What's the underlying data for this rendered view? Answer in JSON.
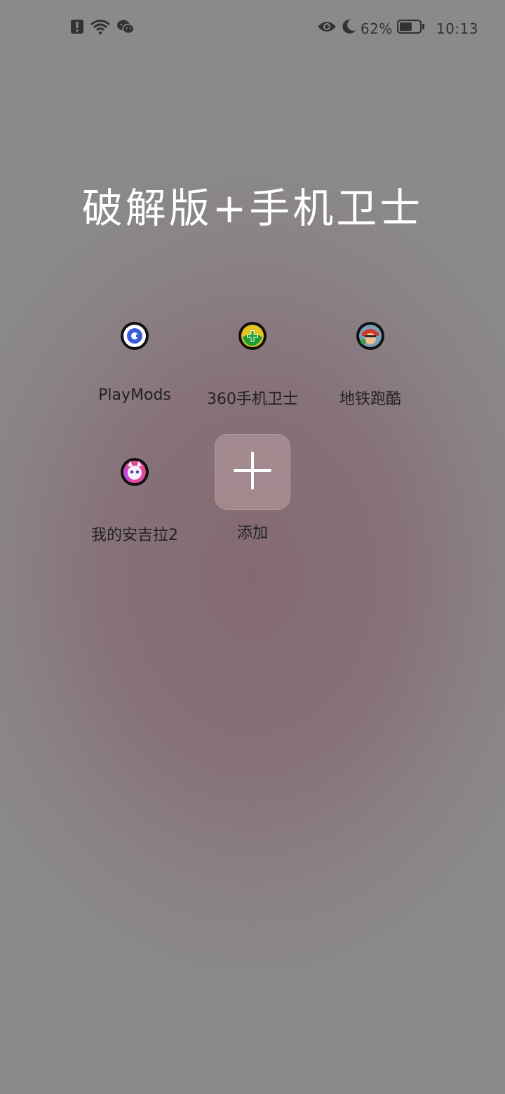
{
  "status_bar": {
    "left_icons": [
      "alert-icon",
      "wifi-icon",
      "wechat-icon"
    ],
    "right_icons": [
      "eye-icon",
      "moon-icon"
    ],
    "battery_percent": "62%",
    "battery_level": 0.62,
    "time": "10:13"
  },
  "folder": {
    "title": "破解版+手机卫士",
    "apps": [
      {
        "label": "PlayMods",
        "icon": "playmods-icon"
      },
      {
        "label": "360手机卫士",
        "icon": "360-security-icon"
      },
      {
        "label": "地铁跑酷",
        "icon": "subway-surfers-icon"
      },
      {
        "label": "我的安吉拉2",
        "icon": "my-talking-angela-2-icon"
      }
    ],
    "add_label": "添加"
  },
  "colors": {
    "title": "#ffffff",
    "label": "#222222",
    "add_tile": "#a58c91"
  }
}
